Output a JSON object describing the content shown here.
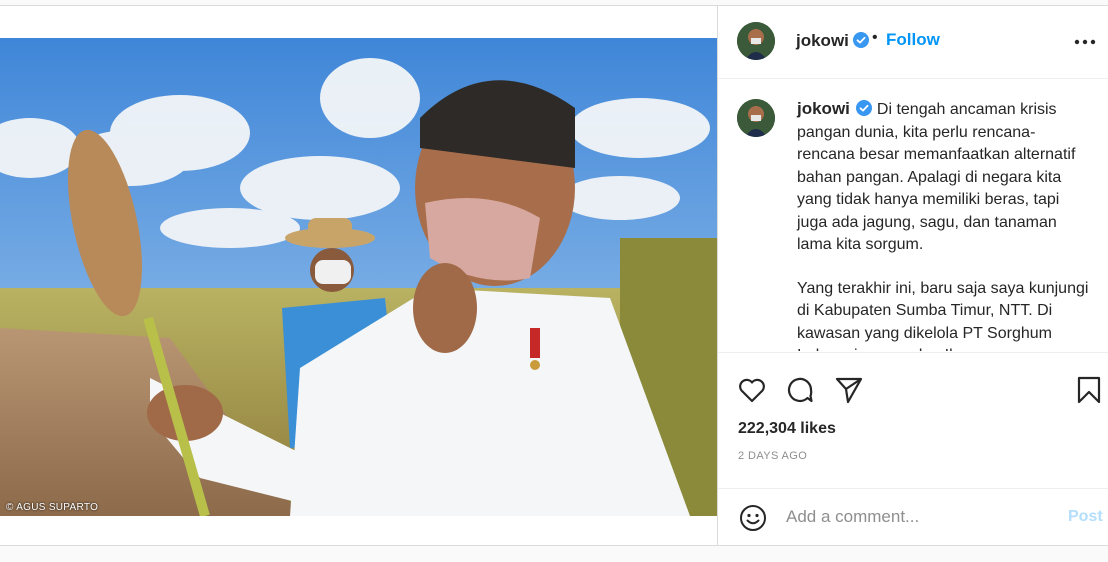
{
  "post": {
    "username": "jokowi",
    "follow_label": "Follow",
    "dot": "•",
    "photo_credit": "© AGUS SUPARTO",
    "caption_paragraphs": [
      "Di tengah ancaman krisis pangan dunia, kita perlu rencana-rencana besar memanfaatkan alternatif bahan pangan. Apalagi di negara kita yang tidak hanya memiliki beras, tapi juga ada jagung, sagu, dan tanaman lama kita sorgum.",
      "Yang terakhir ini, baru saja saya kunjungi di Kabupaten Sumba Timur, NTT. Di kawasan yang dikelola PT Sorghum Indonesia, saya dan Ibu"
    ],
    "likes": "222,304 likes",
    "timestamp": "2 DAYS AGO",
    "comment_placeholder": "Add a comment...",
    "post_label": "Post"
  },
  "icons": [
    "verified-badge-icon",
    "more-options-icon",
    "heart-icon",
    "comment-icon",
    "share-icon",
    "bookmark-icon",
    "emoji-icon"
  ],
  "colors": {
    "accent": "#0095f6",
    "post_disabled": "#b3dffc",
    "text": "#262626",
    "muted": "#8e8e8e"
  }
}
